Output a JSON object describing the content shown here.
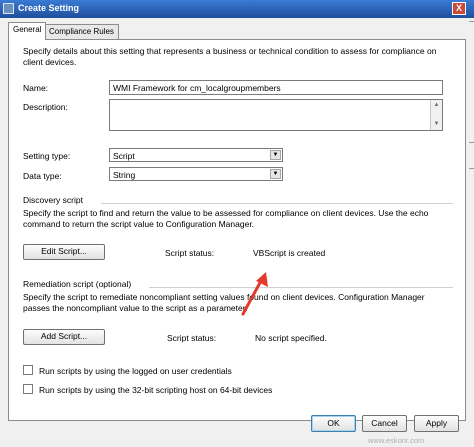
{
  "window": {
    "title": "Create Setting",
    "close_glyph": "X"
  },
  "tabs": [
    {
      "label": "General",
      "active": true
    },
    {
      "label": "Compliance Rules",
      "active": false
    }
  ],
  "general": {
    "intro": "Specify details about this setting that represents a business or technical condition to assess for compliance on client devices.",
    "name_label": "Name:",
    "name_value": "WMI Framework for cm_localgroupmembers",
    "description_label": "Description:",
    "description_value": "",
    "setting_type_label": "Setting type:",
    "setting_type_value": "Script",
    "data_type_label": "Data type:",
    "data_type_value": "String"
  },
  "discovery": {
    "heading": "Discovery script",
    "description": "Specify the script to find and return the value to be assessed for compliance on client devices. Use the echo command to return the script value to Configuration Manager.",
    "button_label": "Edit Script...",
    "status_label": "Script status:",
    "status_value": "VBScript is created"
  },
  "remediation": {
    "heading": "Remediation script (optional)",
    "description": "Specify the script to remediate noncompliant setting values found on client devices. Configuration Manager passes the noncompliant value to the script as a parameter.",
    "button_label": "Add Script...",
    "status_label": "Script status:",
    "status_value": "No script specified."
  },
  "options": [
    {
      "label": "Run scripts by using the logged on user credentials",
      "checked": false
    },
    {
      "label": "Run scripts by using the 32-bit scripting host on 64-bit devices",
      "checked": false
    }
  ],
  "footer": {
    "ok": "OK",
    "cancel": "Cancel",
    "apply": "Apply"
  },
  "watermark": "www.eskonr.com",
  "colors": {
    "title_bar": "#1f4e9c",
    "annotation_arrow": "#e23b2e",
    "panel": "#ffffff"
  }
}
